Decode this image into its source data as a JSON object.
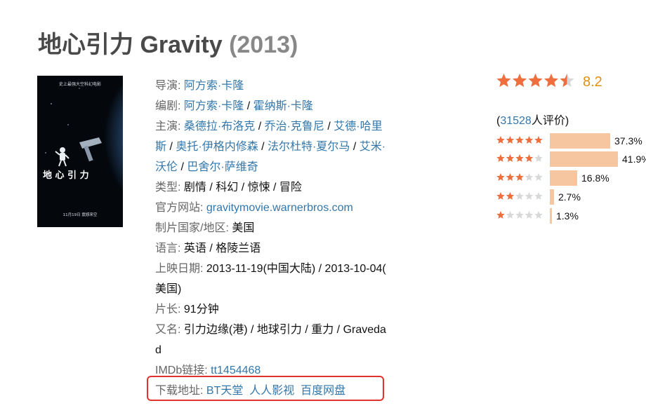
{
  "title": {
    "cn": "地心引力 Gravity",
    "year": "(2013)"
  },
  "poster": {
    "tagline": "史上最强大空科幻电影",
    "title_text": "地 心 引 力",
    "release_text": "11月19日 震撼来空"
  },
  "info": {
    "director_label": "导演:",
    "director": "阿方索·卡隆",
    "writer_label": "编剧:",
    "writer_1": "阿方索·卡隆",
    "writer_sep": " / ",
    "writer_2": "霍纳斯·卡隆",
    "cast_label": "主演:",
    "cast": [
      "桑德拉·布洛克",
      "乔治·克鲁尼",
      "艾德·哈里斯",
      "奥托·伊格内修森",
      "法尔杜特·夏尔马",
      "艾米·沃伦",
      "巴舍尔·萨维奇"
    ],
    "cast_line1_a": "桑德拉·布洛克",
    "cast_line1_b": "乔治·克鲁尼",
    "cast_line1_c": "艾德·哈里",
    "cast_line2_a": "斯",
    "cast_line2_b": "奥托·伊格内修森",
    "cast_line2_c": "法尔杜特·夏尔马",
    "cast_line2_d": "艾米·",
    "cast_line3_a": "沃伦",
    "cast_line3_b": "巴舍尔·萨维奇",
    "genre_label": "类型:",
    "genre": "剧情 / 科幻 / 惊悚 / 冒险",
    "website_label": "官方网站:",
    "website": "gravitymovie.warnerbros.com",
    "country_label": "制片国家/地区:",
    "country": "美国",
    "language_label": "语言:",
    "language": "英语 / 格陵兰语",
    "release_label": "上映日期:",
    "release_line1": "2013-11-19(中国大陆) / 2013-10-04(",
    "release_line2": "美国)",
    "runtime_label": "片长:",
    "runtime": "91分钟",
    "aka_label": "又名:",
    "aka_line1": "引力边缘(港) / 地球引力 / 重力 / Graveda",
    "aka_line2": "d",
    "imdb_label": "IMDb链接:",
    "imdb": "tt1454468",
    "download_label": "下载地址:",
    "download_links": [
      "BT天堂",
      "人人影视",
      "百度网盘"
    ]
  },
  "rating": {
    "score": "8.2",
    "stars_value": 4.5,
    "count_prefix": "(",
    "count_number": "31528",
    "count_suffix": "人评价)",
    "distribution": [
      {
        "stars": 5,
        "percent": "37.3%",
        "value": 37.3
      },
      {
        "stars": 4,
        "percent": "41.9%",
        "value": 41.9
      },
      {
        "stars": 3,
        "percent": "16.8%",
        "value": 16.8
      },
      {
        "stars": 2,
        "percent": "2.7%",
        "value": 2.7
      },
      {
        "stars": 1,
        "percent": "1.3%",
        "value": 1.3
      }
    ]
  },
  "colors": {
    "link": "#3377aa",
    "star_filled": "#ee6f3d",
    "star_empty": "#d8d8d8",
    "bar": "#f5c6a0",
    "highlight_border": "#e0332e"
  }
}
